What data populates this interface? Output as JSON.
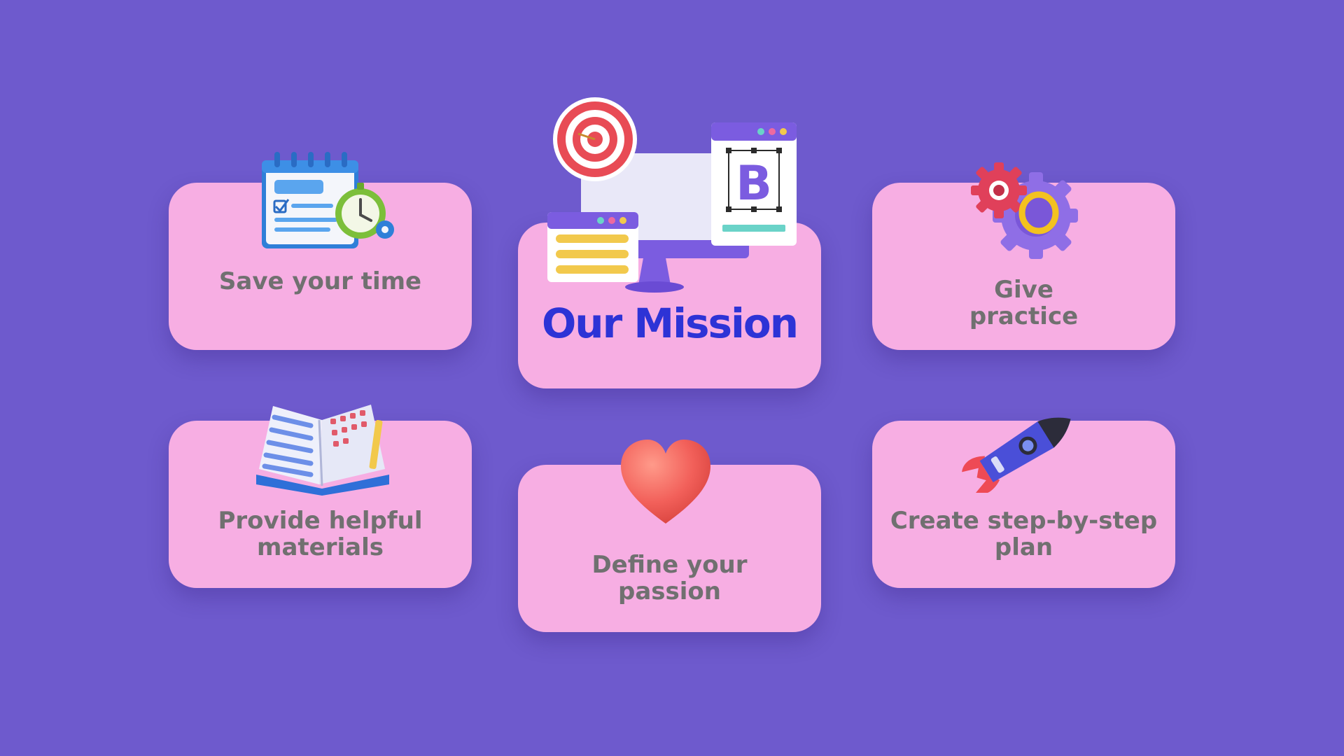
{
  "colors": {
    "background": "#6e5acd",
    "card": "#f7aee3",
    "label": "#707070",
    "title": "#2d33d6"
  },
  "center": {
    "title": "Our Mission",
    "icon": "monitor-target-icon"
  },
  "cards": {
    "save_time": {
      "label": "Save your time",
      "icon": "calendar-clock-icon"
    },
    "give_practice": {
      "label": "Give\npractice",
      "icon": "gears-icon"
    },
    "materials": {
      "label": "Provide helpful\nmaterials",
      "icon": "open-book-icon"
    },
    "passion": {
      "label": "Define your\npassion",
      "icon": "heart-icon"
    },
    "plan": {
      "label": "Create step-by-step\nplan",
      "icon": "rocket-icon"
    }
  }
}
